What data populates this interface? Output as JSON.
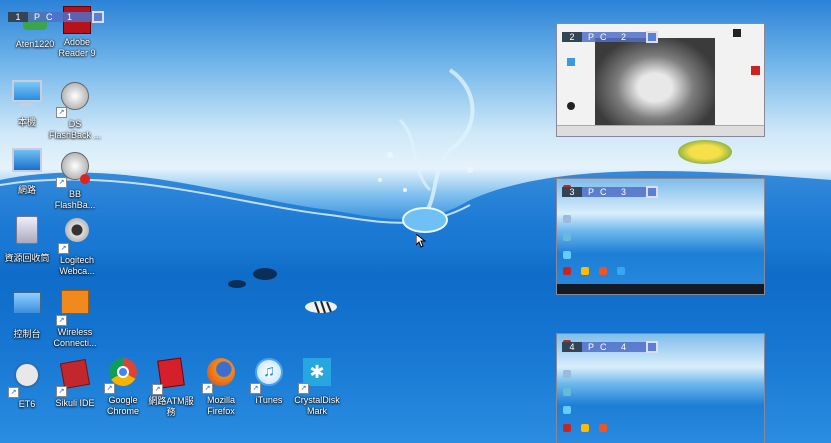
{
  "screen_labels": [
    {
      "num": "1",
      "text": "PC 1"
    },
    {
      "num": "2",
      "text": "PC 2"
    },
    {
      "num": "3",
      "text": "PC 3"
    },
    {
      "num": "4",
      "text": "PC 4"
    }
  ],
  "desktop_icons": [
    {
      "label": "Aten1220",
      "icon": "aten-icon"
    },
    {
      "label": "Adobe\nReader 9",
      "icon": "adobe-reader-icon"
    },
    {
      "label": "本機",
      "icon": "computer-icon"
    },
    {
      "label": "DS\nFlashBack ...",
      "icon": "flashback-icon"
    },
    {
      "label": "網路",
      "icon": "network-icon"
    },
    {
      "label": "BB\nFlashBa...",
      "icon": "flashback-player-icon"
    },
    {
      "label": "資源回收筒",
      "icon": "recycle-bin-icon"
    },
    {
      "label": "Logitech\nWebca...",
      "icon": "webcam-icon"
    },
    {
      "label": "控制台",
      "icon": "control-panel-icon"
    },
    {
      "label": "Wireless\nConnecti...",
      "icon": "dlink-wireless-icon"
    },
    {
      "label": "ET6",
      "icon": "et6-icon"
    },
    {
      "label": "Sikuli IDE",
      "icon": "sikuli-icon"
    },
    {
      "label": "Google\nChrome",
      "icon": "chrome-icon"
    },
    {
      "label": "網路ATM服\n務",
      "icon": "atm-icon"
    },
    {
      "label": "Mozilla\nFirefox",
      "icon": "firefox-icon"
    },
    {
      "label": "iTunes",
      "icon": "itunes-icon"
    },
    {
      "label": "CrystalDisk\nMark",
      "icon": "crystaldiskmark-icon"
    }
  ],
  "colors": {
    "water": "#0f6cc9",
    "sky": "#cfe8f8",
    "label_bar": "#506ec8"
  }
}
